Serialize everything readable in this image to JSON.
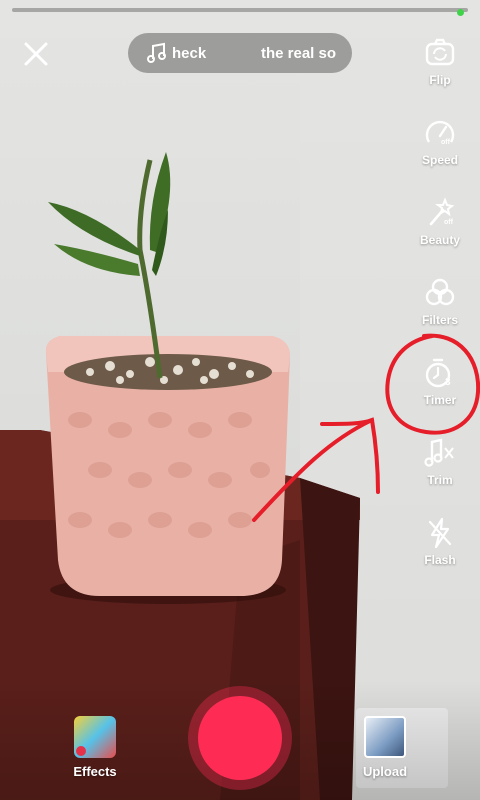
{
  "top": {
    "sound_title_left": "heck",
    "sound_title_right": "the real so"
  },
  "rail": {
    "items": [
      {
        "label": "Flip",
        "icon": "flip-camera-icon"
      },
      {
        "label": "Speed",
        "icon": "speed-icon"
      },
      {
        "label": "Beauty",
        "icon": "beauty-wand-icon"
      },
      {
        "label": "Filters",
        "icon": "filters-icon"
      },
      {
        "label": "Timer",
        "icon": "timer-icon"
      },
      {
        "label": "Trim",
        "icon": "trim-icon"
      },
      {
        "label": "Flash",
        "icon": "flash-off-icon"
      }
    ]
  },
  "bottom": {
    "effects_label": "Effects",
    "upload_label": "Upload"
  },
  "colors": {
    "record": "#fe2c55",
    "annotation": "#e51e2a"
  }
}
